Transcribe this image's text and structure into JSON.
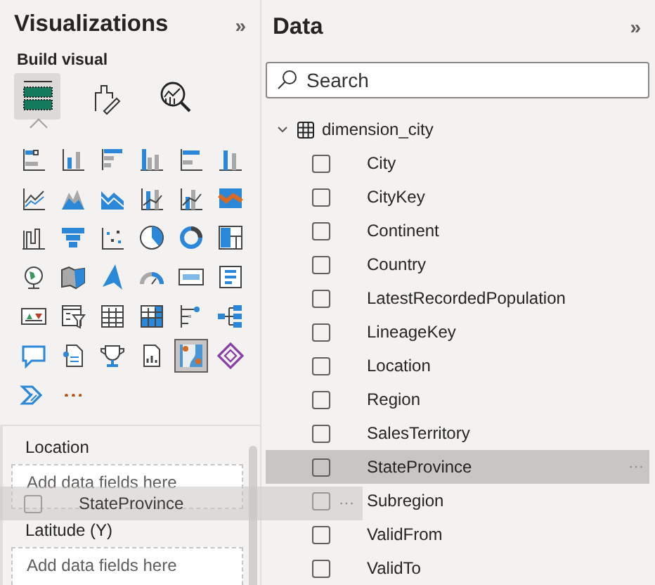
{
  "visualizations": {
    "title": "Visualizations",
    "collapse": "»",
    "section": "Build visual",
    "build_tabs": [
      {
        "selected": true
      },
      {
        "selected": false
      },
      {
        "selected": false
      }
    ],
    "visuals": [
      {
        "selected": false
      },
      {
        "selected": false
      },
      {
        "selected": false
      },
      {
        "selected": false
      },
      {
        "selected": false
      },
      {
        "selected": false
      },
      {
        "selected": false
      },
      {
        "selected": false
      },
      {
        "selected": false
      },
      {
        "selected": false
      },
      {
        "selected": false
      },
      {
        "selected": false
      },
      {
        "selected": false
      },
      {
        "selected": false
      },
      {
        "selected": false
      },
      {
        "selected": false
      },
      {
        "selected": false
      },
      {
        "selected": false
      },
      {
        "selected": false
      },
      {
        "selected": false
      },
      {
        "selected": false
      },
      {
        "selected": false
      },
      {
        "selected": false
      },
      {
        "selected": false
      },
      {
        "selected": false
      },
      {
        "selected": false
      },
      {
        "selected": false
      },
      {
        "selected": false
      },
      {
        "selected": false
      },
      {
        "selected": false
      },
      {
        "selected": false
      },
      {
        "selected": false
      },
      {
        "selected": false
      },
      {
        "selected": false
      },
      {
        "selected": true
      },
      {
        "selected": false
      },
      {
        "selected": false
      },
      {
        "selected": false
      }
    ],
    "wells": [
      {
        "label": "Location",
        "placeholder": "Add data fields here"
      },
      {
        "label": "Latitude (Y)",
        "placeholder": "Add data fields here"
      }
    ]
  },
  "data": {
    "title": "Data",
    "collapse": "»",
    "search": {
      "placeholder": "Search"
    },
    "table": {
      "name": "dimension_city",
      "expanded": true,
      "fields": [
        {
          "name": "City",
          "checked": false,
          "hovered": false
        },
        {
          "name": "CityKey",
          "checked": false,
          "hovered": false
        },
        {
          "name": "Continent",
          "checked": false,
          "hovered": false
        },
        {
          "name": "Country",
          "checked": false,
          "hovered": false
        },
        {
          "name": "LatestRecordedPopulation",
          "checked": false,
          "hovered": false
        },
        {
          "name": "LineageKey",
          "checked": false,
          "hovered": false
        },
        {
          "name": "Location",
          "checked": false,
          "hovered": false
        },
        {
          "name": "Region",
          "checked": false,
          "hovered": false
        },
        {
          "name": "SalesTerritory",
          "checked": false,
          "hovered": false
        },
        {
          "name": "StateProvince",
          "checked": false,
          "hovered": true,
          "more": "···"
        },
        {
          "name": "Subregion",
          "checked": false,
          "hovered": false
        },
        {
          "name": "ValidFrom",
          "checked": false,
          "hovered": false
        },
        {
          "name": "ValidTo",
          "checked": false,
          "hovered": false
        }
      ]
    }
  },
  "drag_ghost": {
    "label": "StateProvince",
    "checked": false,
    "more": "···"
  }
}
